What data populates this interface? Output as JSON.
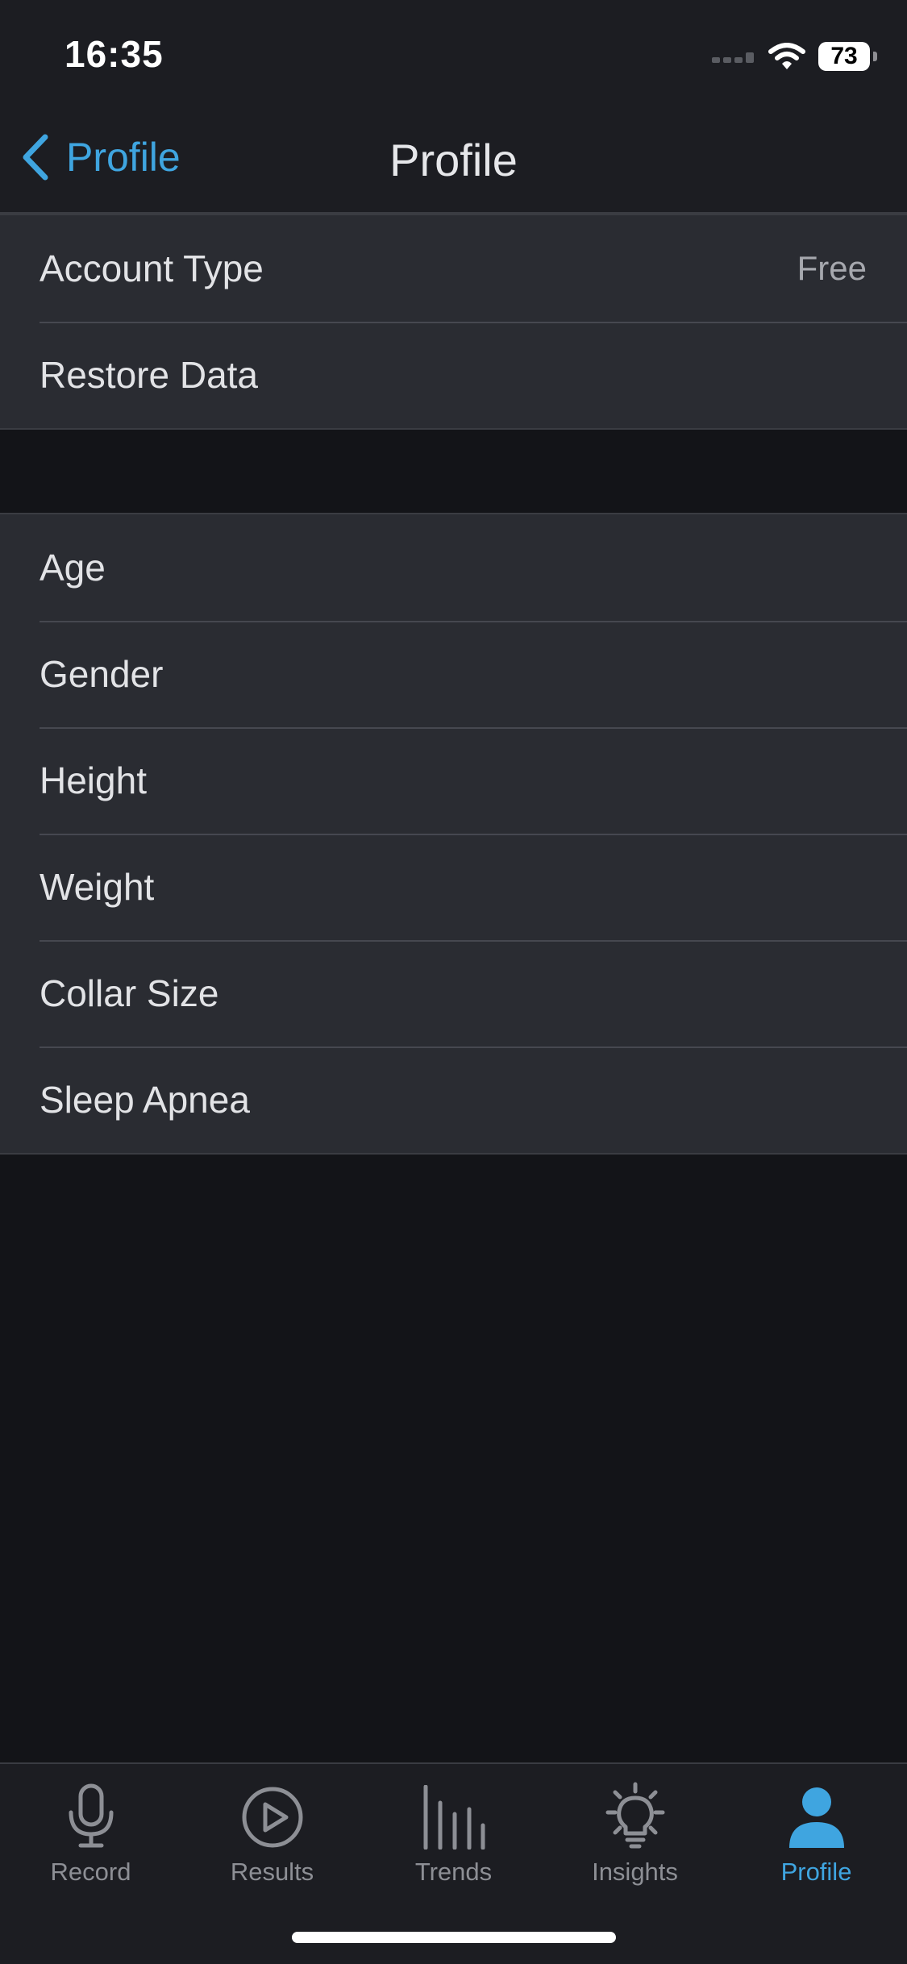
{
  "status_bar": {
    "time": "16:35",
    "battery": "73"
  },
  "nav": {
    "back_label": "Profile",
    "title": "Profile"
  },
  "account_section": {
    "rows": [
      {
        "label": "Account Type",
        "value": "Free"
      },
      {
        "label": "Restore Data"
      }
    ]
  },
  "profile_section": {
    "rows": [
      {
        "label": "Age"
      },
      {
        "label": "Gender"
      },
      {
        "label": "Height"
      },
      {
        "label": "Weight"
      },
      {
        "label": "Collar Size"
      },
      {
        "label": "Sleep Apnea"
      }
    ]
  },
  "tab_bar": {
    "active_tab": "Profile",
    "tabs": [
      {
        "label": "Record",
        "icon": "microphone-icon"
      },
      {
        "label": "Results",
        "icon": "play-circle-icon"
      },
      {
        "label": "Trends",
        "icon": "bar-chart-icon"
      },
      {
        "label": "Insights",
        "icon": "lightbulb-icon"
      },
      {
        "label": "Profile",
        "icon": "person-icon"
      }
    ]
  },
  "colors": {
    "accent": "#3fa5e0",
    "background": "#131418",
    "bar_background": "#1c1d22",
    "cell_background": "#2a2c32",
    "inactive_tab": "#8d8f95"
  }
}
